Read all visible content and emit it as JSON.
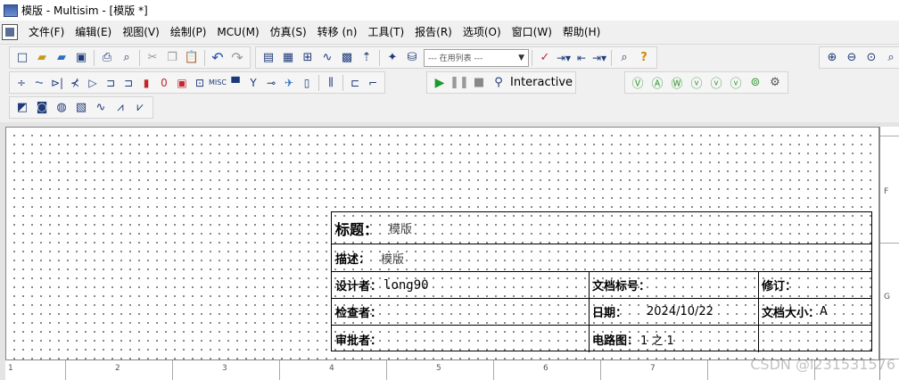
{
  "window": {
    "title": "模版 - Multisim - [模版 *]"
  },
  "menu": [
    "文件(F)",
    "编辑(E)",
    "视图(V)",
    "绘制(P)",
    "MCU(M)",
    "仿真(S)",
    "转移 (n)",
    "工具(T)",
    "报告(R)",
    "选项(O)",
    "窗口(W)",
    "帮助(H)"
  ],
  "toolbar": {
    "list_combo": "--- 在用列表 ---",
    "sim_mode": "Interactive"
  },
  "icons": {
    "standard": [
      "new-icon",
      "open-icon",
      "open-samples-icon",
      "save-icon",
      "print-icon",
      "print-preview-icon",
      "cut-icon",
      "copy-icon",
      "paste-icon",
      "undo-icon",
      "redo-icon"
    ],
    "view": [
      "toggle-design-toolbox-icon",
      "spreadsheet-view-icon",
      "sim-browser-icon",
      "grapher-icon",
      "post-processor-icon",
      "parent-sheet-icon",
      "component-wizard-icon",
      "database-manager-icon"
    ],
    "zoom": [
      "zoom-in-icon",
      "zoom-out-icon",
      "zoom-area-icon",
      "zoom-fit-icon"
    ],
    "components": [
      "source-icon",
      "basic-icon",
      "diode-icon",
      "transistor-icon",
      "analog-icon",
      "ttl-icon",
      "cmos-icon",
      "mcu-icon",
      "advanced-peripherals-icon",
      "misc-digital-icon",
      "mixed-icon",
      "indicator-icon",
      "power-icon",
      "misc-icon",
      "rf-icon",
      "electromechanical-icon",
      "ni-components-icon",
      "connectors-icon",
      "hierarchical-block-icon",
      "bus-icon"
    ],
    "simulation": [
      "run-icon",
      "pause-icon",
      "stop-icon",
      "probe-icon"
    ],
    "probes": [
      "voltage-probe-icon",
      "current-probe-icon",
      "power-probe-icon",
      "differential-probe-icon",
      "voltage-reference-probe-icon",
      "digital-probe-icon",
      "probe-settings-icon"
    ],
    "instruments": [
      "multimeter-icon",
      "function-generator-icon",
      "wattmeter-icon",
      "oscilloscope-icon",
      "bode-plotter-icon",
      "spectrum-icon",
      "network-analyzer-icon"
    ]
  },
  "titleblock": {
    "title_label": "标题：",
    "title_value": "模版",
    "desc_label": "描述：",
    "desc_value": "模版",
    "designer_label": "设计者：",
    "designer_value": "long90",
    "docno_label": "文档标号：",
    "docno_value": "",
    "revision_label": "修订：",
    "revision_value": "",
    "checker_label": "检查者：",
    "checker_value": "",
    "date_label": "日期：",
    "date_value": "2024/10/22",
    "docsize_label": "文档大小：",
    "docsize_value": "A",
    "approver_label": "审批者：",
    "approver_value": "",
    "sheet_label": "电路图：",
    "sheet_value": "1 之 1"
  },
  "rulers": {
    "bottom": [
      "1",
      "2",
      "3",
      "4",
      "5",
      "6",
      "7"
    ],
    "right": [
      "F",
      "G"
    ]
  },
  "watermark": "CSDN @l231531576"
}
